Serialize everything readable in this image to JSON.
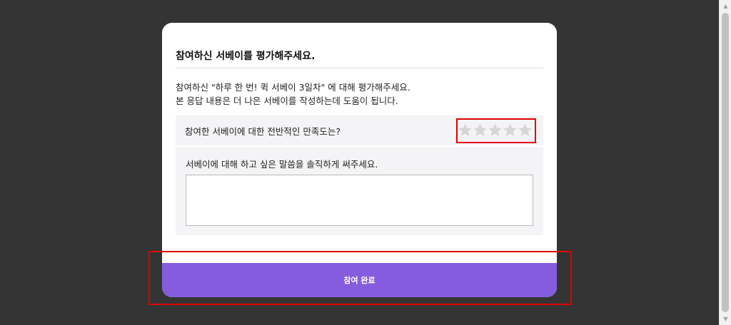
{
  "modal": {
    "title": "참여하신 서베이를 평가해주세요.",
    "description_line1": "참여하신 \"하루 한 번! 퀵 서베이 3일차\" 에 대해 평가해주세요.",
    "description_line2": "본 응답 내용은 더 나은 서베이를 작성하는데 도움이 됩니다."
  },
  "rating": {
    "label": "참여한 서베이에 대한 전반적인 만족도는?",
    "max_stars": 5,
    "selected_stars": 0,
    "star_color": "#d6d6d6"
  },
  "comment": {
    "label": "서베이에 대해 하고 싶은 말씀을 솔직하게 써주세요.",
    "value": ""
  },
  "submit": {
    "label": "참여 완료",
    "color": "#865cde"
  },
  "annotations": {
    "highlight_color": "#e00000"
  }
}
